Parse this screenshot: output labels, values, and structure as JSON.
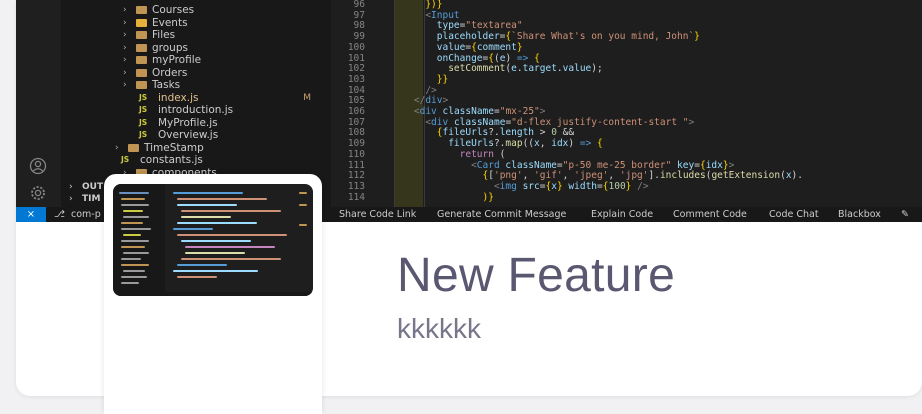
{
  "explorer": {
    "items": [
      {
        "label": "Courses",
        "kind": "folder"
      },
      {
        "label": "Events",
        "kind": "folder-special"
      },
      {
        "label": "Files",
        "kind": "folder"
      },
      {
        "label": "groups",
        "kind": "folder"
      },
      {
        "label": "myProfile",
        "kind": "folder"
      },
      {
        "label": "Orders",
        "kind": "folder"
      },
      {
        "label": "Tasks",
        "kind": "folder"
      },
      {
        "label": "index.js",
        "kind": "js",
        "badge": "M"
      },
      {
        "label": "introduction.js",
        "kind": "js"
      },
      {
        "label": "MyProfile.js",
        "kind": "js"
      },
      {
        "label": "Overview.js",
        "kind": "js"
      },
      {
        "label": "TimeStamp",
        "kind": "folder"
      },
      {
        "label": "constants.js",
        "kind": "js"
      },
      {
        "label": "components",
        "kind": "folder"
      }
    ],
    "outline_label": "OUT",
    "timeline_label": "TIM"
  },
  "editor": {
    "line_numbers": [
      "96",
      "97",
      "98",
      "99",
      "100",
      "101",
      "102",
      "103",
      "104",
      "105",
      "106",
      "107",
      "108",
      "109",
      "110",
      "111",
      "112",
      "113",
      "114"
    ]
  },
  "statusbar": {
    "remote_icon": "remote-icon",
    "branch": "com-p",
    "items": [
      "Share Code Link",
      "Generate Commit Message",
      "Explain Code",
      "Comment Code",
      "Code Chat",
      "Blackbox"
    ]
  },
  "post": {
    "title": "New Feature",
    "subtitle": "kkkkkk"
  },
  "colors": {
    "title": "#5a5870",
    "subtitle": "#77768a",
    "statusbar_accent": "#0078d4"
  }
}
